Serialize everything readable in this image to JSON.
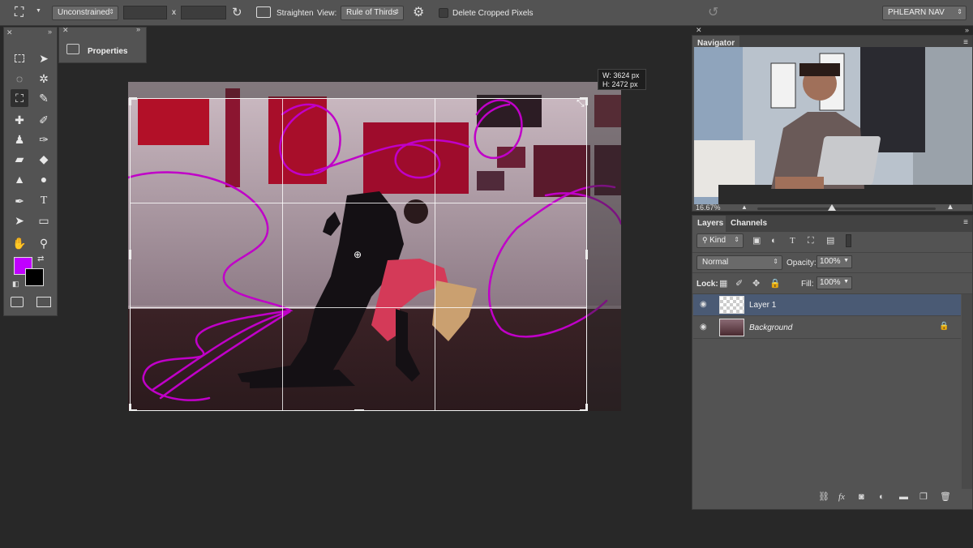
{
  "options_bar": {
    "ratio_preset": "Unconstrained",
    "width_value": "",
    "height_value": "",
    "times_sign": "x",
    "straighten_label": "Straighten",
    "view_label": "View:",
    "overlay_value": "Rule of Thirds",
    "delete_cropped_label": "Delete Cropped Pixels",
    "delete_cropped_checked": false,
    "workspace": "PHLEARN NAV"
  },
  "properties_panel": {
    "title": "Properties"
  },
  "foreground_color": "#c000ff",
  "background_color": "#000000",
  "crop_tooltip": {
    "width": "W: 3624 px",
    "height": "H: 2472 px"
  },
  "navigator": {
    "title": "Navigator",
    "zoom": "16.67%",
    "zoom_slider_fraction": 0.42
  },
  "layers_panel": {
    "tabs": [
      "Layers",
      "Channels"
    ],
    "active_tab": "Layers",
    "filter_kind": "Kind",
    "blend_mode": "Normal",
    "opacity_label": "Opacity:",
    "opacity_value": "100%",
    "lock_label": "Lock:",
    "fill_label": "Fill:",
    "fill_value": "100%",
    "layers": [
      {
        "name": "Layer 1",
        "selected": true,
        "visible": true,
        "locked": false
      },
      {
        "name": "Background",
        "selected": false,
        "visible": true,
        "locked": true
      }
    ]
  },
  "colors": {
    "accent_selection": "#4a5a74",
    "brush_stroke": "#c000c8"
  }
}
